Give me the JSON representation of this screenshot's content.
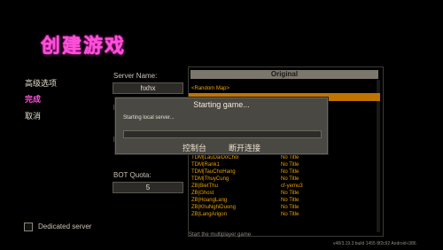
{
  "page_title": "创建游戏",
  "left_menu": {
    "advanced": "高级选项",
    "done": "完成",
    "cancel": "取消"
  },
  "server": {
    "name_label": "Server Name:",
    "name_value": "hxhx",
    "label_m": "M",
    "label_p": "P",
    "bot_quota_label": "BOT Quota:",
    "bot_quota_value": "5"
  },
  "map_list": {
    "header": "Original",
    "rows": [
      {
        "name": "<Random Map>",
        "title": "",
        "selected": false
      },
      {
        "name": "",
        "title": "",
        "selected": true
      },
      {
        "name": "TDM|LauDaiDoChoi",
        "title": "No Title",
        "selected": false
      },
      {
        "name": "TDM|Rank1",
        "title": "No Title",
        "selected": false
      },
      {
        "name": "TDM|TauChoHang",
        "title": "No Title",
        "selected": false
      },
      {
        "name": "TDM|ThuyCung",
        "title": "No Title",
        "selected": false
      },
      {
        "name": "ZB|BietThu",
        "title": "cf-yemu3",
        "selected": false
      },
      {
        "name": "ZB|Ghost",
        "title": "No Title",
        "selected": false
      },
      {
        "name": "ZB|HoangLang",
        "title": "No Title",
        "selected": false
      },
      {
        "name": "ZB|KhuNghiDuong",
        "title": "No Title",
        "selected": false
      },
      {
        "name": "ZB|LangArigon",
        "title": "No Title",
        "selected": false
      }
    ]
  },
  "dialog": {
    "title": "Starting game...",
    "message": "Starting local server...",
    "progress": 0,
    "console_button": "控制台",
    "disconnect_button": "断开连接"
  },
  "dedicated_server_label": "Dedicated server",
  "footer_hint": "Start the multiplayer game",
  "version": "v48/3.19.3  build 1455  8f2c92  Android-i386",
  "colors": {
    "title_pink": "#ff4fd8",
    "map_text": "#e8a000",
    "selected_row": "#c07400"
  }
}
